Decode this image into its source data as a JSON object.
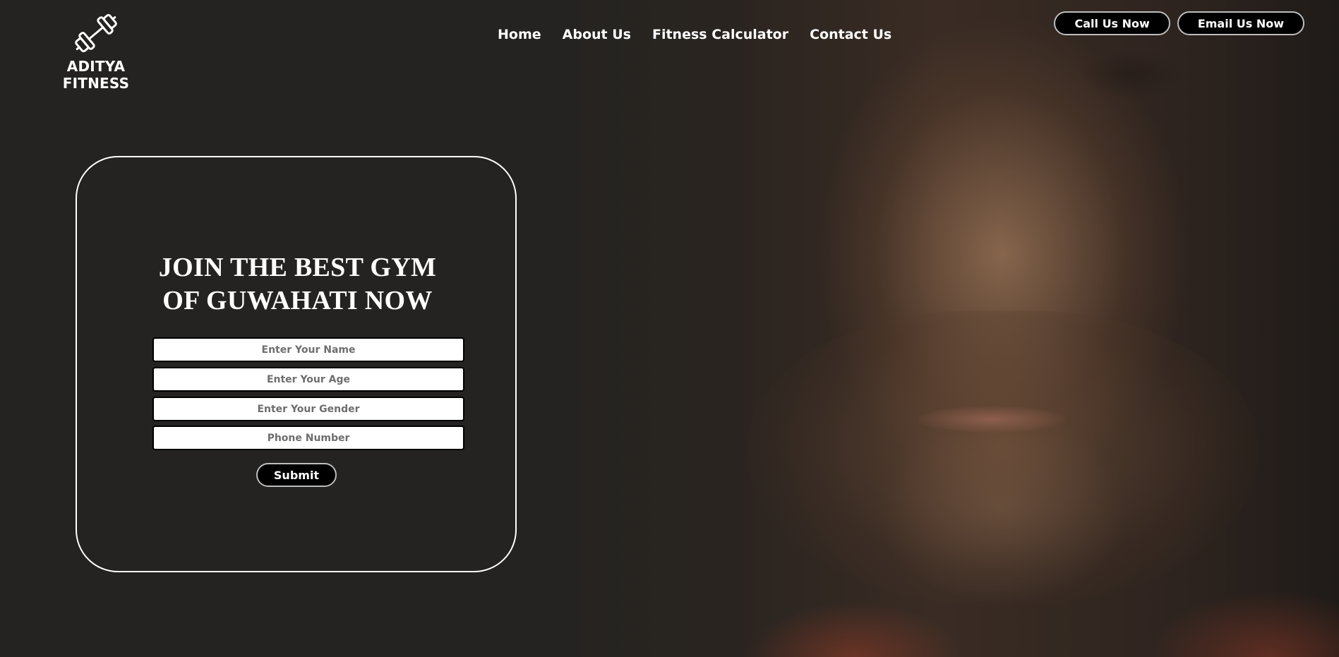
{
  "brand": {
    "name": "ADITYA FITNESS",
    "logo_icon": "dumbbell-icon"
  },
  "nav": {
    "items": [
      {
        "label": "Home"
      },
      {
        "label": "About Us"
      },
      {
        "label": "Fitness Calculator"
      },
      {
        "label": "Contact Us"
      }
    ]
  },
  "header_actions": {
    "call_label": "Call Us Now",
    "email_label": "Email Us Now"
  },
  "form": {
    "title_line1": "JOIN THE BEST GYM",
    "title_line2": "OF GUWAHATI NOW",
    "name_placeholder": "Enter Your Name",
    "age_placeholder": "Enter Your Age",
    "gender_placeholder": "Enter Your Gender",
    "phone_placeholder": "Phone Number",
    "submit_label": "Submit"
  },
  "colors": {
    "background": "#242321",
    "text": "#ffffff",
    "button_bg": "#000000",
    "button_border": "#bdbdbd"
  }
}
